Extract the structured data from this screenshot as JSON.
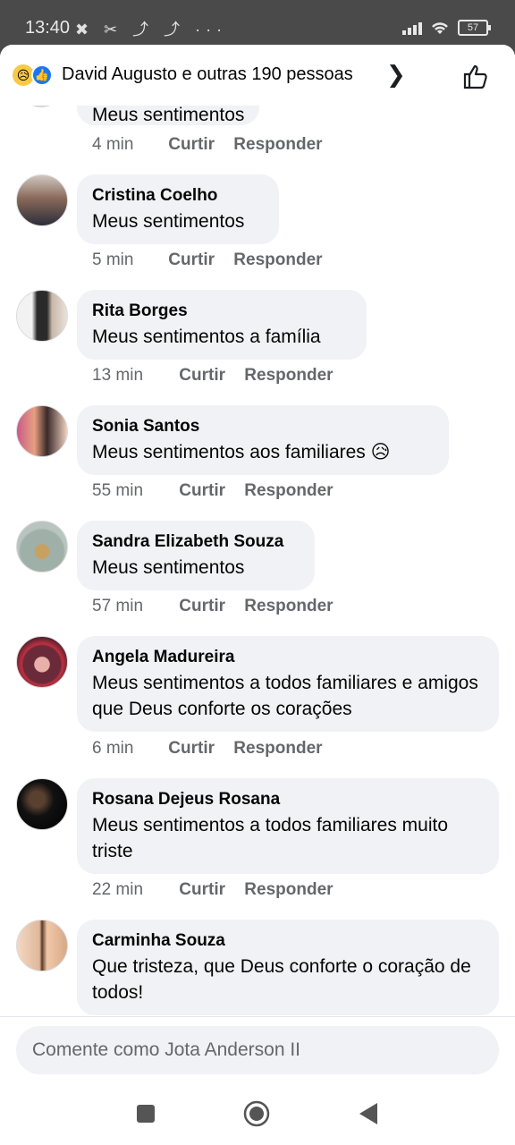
{
  "status_bar": {
    "time": "13:40",
    "notification_icons": "✖ ✂ ⤴ ⤴ ···",
    "battery": "57"
  },
  "header": {
    "reactions": [
      "sad-reaction",
      "like-reaction"
    ],
    "text": "David Augusto e outras 190 pessoas",
    "chevron": "❯"
  },
  "partial_comment": {
    "text": "Meus sentimentos",
    "time": "4 min"
  },
  "actions": {
    "like": "Curtir",
    "reply": "Responder"
  },
  "comments": [
    {
      "name": "Cristina Coelho",
      "text": "Meus sentimentos",
      "time": "5 min"
    },
    {
      "name": "Rita Borges",
      "text": "Meus sentimentos a família",
      "time": "13 min"
    },
    {
      "name": "Sonia Santos",
      "text": "Meus sentimentos aos familiares 😥",
      "time": "55 min"
    },
    {
      "name": "Sandra Elizabeth Souza",
      "text": "Meus sentimentos",
      "time": "57 min"
    },
    {
      "name": "Angela Madureira",
      "text": "Meus sentimentos a todos familiares e amigos que Deus conforte os corações",
      "time": "6 min"
    },
    {
      "name": "Rosana Dejeus Rosana",
      "text": "Meus sentimentos a todos familiares muito triste",
      "time": "22 min"
    },
    {
      "name": "Carminha Souza",
      "text": "Que tristeza, que Deus conforte o coração de todos!",
      "time": ""
    }
  ],
  "composer": {
    "placeholder": "Comente como Jota Anderson II"
  },
  "colors": {
    "bubble": "#f0f2f5",
    "meta": "#65676b",
    "accent": "#1877f2"
  }
}
